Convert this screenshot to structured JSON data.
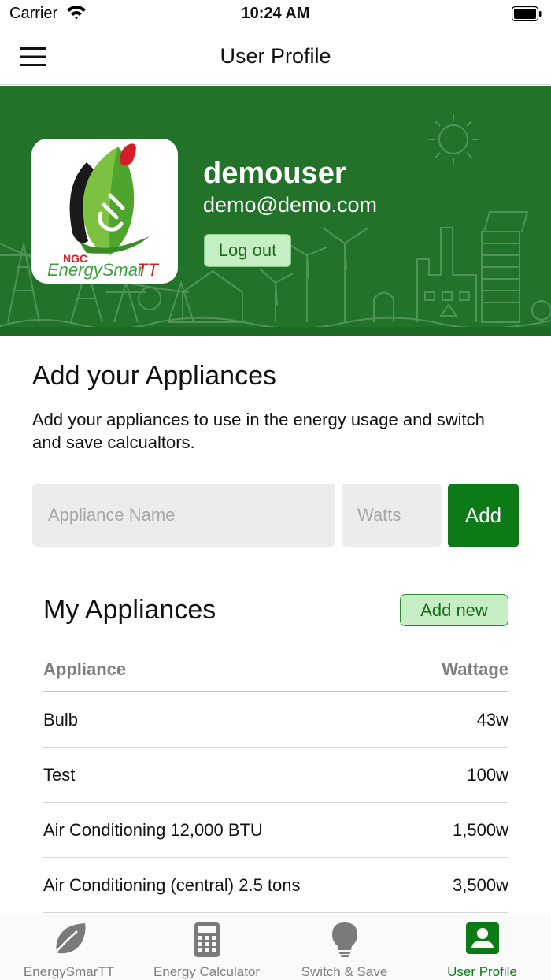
{
  "status_bar": {
    "carrier": "Carrier",
    "time": "10:24 AM"
  },
  "nav": {
    "title": "User Profile",
    "menu_icon": "hamburger-menu-icon"
  },
  "profile": {
    "username": "demouser",
    "email": "demo@demo.com",
    "logout_label": "Log out",
    "logo": {
      "brand_top": "NGC",
      "brand_name": "EnergySmarTT"
    }
  },
  "add_section": {
    "title": "Add your Appliances",
    "description": "Add your appliances to use in the energy usage and switch and save calcualtors.",
    "name_placeholder": "Appliance Name",
    "watts_placeholder": "Watts",
    "add_label": "Add"
  },
  "my_appliances": {
    "title": "My Appliances",
    "add_new_label": "Add new",
    "columns": [
      "Appliance",
      "Wattage"
    ],
    "rows": [
      {
        "name": "Bulb",
        "wattage": "43w"
      },
      {
        "name": "Test",
        "wattage": "100w"
      },
      {
        "name": "Air Conditioning 12,000 BTU",
        "wattage": "1,500w"
      },
      {
        "name": "Air Conditioning (central) 2.5 tons",
        "wattage": "3,500w"
      }
    ]
  },
  "tabs": [
    {
      "label": "EnergySmarTT",
      "icon": "leaf-icon",
      "active": false
    },
    {
      "label": "Energy Calculator",
      "icon": "calculator-icon",
      "active": false
    },
    {
      "label": "Switch & Save",
      "icon": "lightbulb-icon",
      "active": false
    },
    {
      "label": "User Profile",
      "icon": "user-profile-icon",
      "active": true
    }
  ],
  "colors": {
    "brand_green": "#0c7a16",
    "hero_green": "#23722a",
    "soft_green": "#c6eec4",
    "inactive_tab": "#7f7f7f"
  }
}
